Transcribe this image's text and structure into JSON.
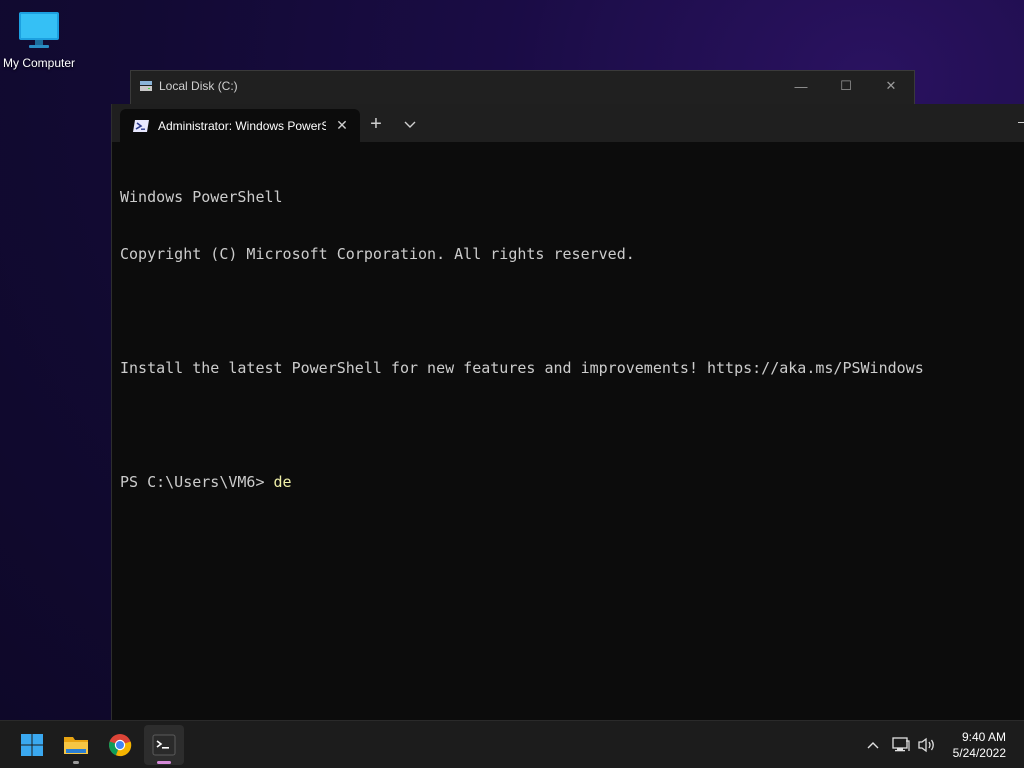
{
  "desktop": {
    "icons": [
      {
        "label": "My Computer",
        "icon": "monitor-icon"
      }
    ]
  },
  "background_window": {
    "title": "Local Disk (C:)",
    "icon": "drive-icon",
    "controls": {
      "minimize": "—",
      "maximize": "☐",
      "close": "✕"
    }
  },
  "terminal": {
    "tab": {
      "label": "Administrator: Windows PowerShell",
      "icon": "powershell-icon",
      "close": "✕"
    },
    "new_tab": "+",
    "dropdown_icon": "chevron-down-icon",
    "lines": [
      "Windows PowerShell",
      "Copyright (C) Microsoft Corporation. All rights reserved.",
      "",
      "Install the latest PowerShell for new features and improvements! https://aka.ms/PSWindows",
      ""
    ],
    "prompt": "PS C:\\Users\\VM6> ",
    "command": "de",
    "colors": {
      "background": "#0c0c0c",
      "text": "#cccccc",
      "command": "#f0f0a8"
    }
  },
  "taskbar": {
    "apps": [
      {
        "name": "start",
        "icon": "windows-start-icon",
        "active": false
      },
      {
        "name": "file-explorer",
        "icon": "folder-icon",
        "active": false,
        "running": true
      },
      {
        "name": "chrome",
        "icon": "chrome-icon",
        "active": false
      },
      {
        "name": "terminal",
        "icon": "terminal-icon",
        "active": true,
        "running": true
      }
    ],
    "tray": {
      "overflow_icon": "chevron-up-icon",
      "network_icon": "network-icon",
      "volume_icon": "volume-icon"
    },
    "clock": {
      "time": "9:40 AM",
      "date": "5/24/2022"
    }
  }
}
